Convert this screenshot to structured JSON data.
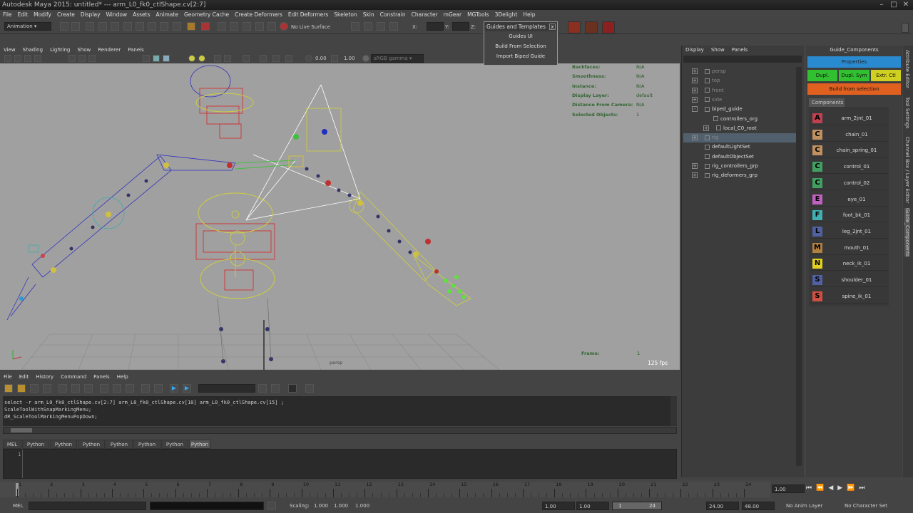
{
  "window": {
    "title": "Autodesk Maya 2015: untitled*   ---   arm_L0_fk0_ctlShape.cv[2:7]"
  },
  "menubar": {
    "items": [
      "File",
      "Edit",
      "Modify",
      "Create",
      "Display",
      "Window",
      "Assets",
      "Animate",
      "Geometry Cache",
      "Create Deformers",
      "Edit Deformers",
      "Skeleton",
      "Skin",
      "Constrain",
      "Character",
      "mGear",
      "MGTools",
      "3Delight",
      "Help"
    ]
  },
  "statusline": {
    "menuset": "Animation",
    "live_surface": "No Live Surface",
    "x_label": "X:",
    "y_label": "Y:",
    "z_label": "Z:"
  },
  "popup": {
    "title": "Guides and Templates",
    "close": "x",
    "items": [
      "Guides UI",
      "Build From Selection",
      "Import Biped Guide"
    ]
  },
  "viewport": {
    "menu": [
      "View",
      "Shading",
      "Lighting",
      "Show",
      "Renderer",
      "Panels"
    ],
    "exposure": "0.00",
    "gamma": "1.00",
    "color_space": "sRGB gamma",
    "camera": "persp",
    "fps": "125 fps",
    "hud": [
      {
        "k": "Backfaces:",
        "v": "N/A"
      },
      {
        "k": "Smoothness:",
        "v": "N/A"
      },
      {
        "k": "Instance:",
        "v": "N/A"
      },
      {
        "k": "Display Layer:",
        "v": "default"
      },
      {
        "k": "Distance From Camera:",
        "v": "N/A"
      },
      {
        "k": "Selected Objects:",
        "v": "1"
      }
    ],
    "frame_label": "Frame:",
    "frame_value": "1"
  },
  "outliner": {
    "menu": [
      "Display",
      "Show",
      "Panels"
    ],
    "rows": [
      {
        "label": "persp",
        "dim": true
      },
      {
        "label": "top",
        "dim": true
      },
      {
        "label": "front",
        "dim": true
      },
      {
        "label": "side",
        "dim": true
      },
      {
        "label": "biped_guide",
        "dim": false
      },
      {
        "label": "controllers_org",
        "dim": false
      },
      {
        "label": "local_C0_root",
        "dim": false
      },
      {
        "label": "rig",
        "dim": true
      },
      {
        "label": "defaultLightSet",
        "dim": false
      },
      {
        "label": "defaultObjectSet",
        "dim": false
      },
      {
        "label": "rig_controllers_grp",
        "dim": false
      },
      {
        "label": "rig_deformers_grp",
        "dim": false
      }
    ]
  },
  "guide_panel": {
    "title": "Guide_Components",
    "properties": "Properties",
    "dupl": "Dupl.",
    "dupl_sym": "Dupl. Sym",
    "extr_ctl": "Extr. Ctl",
    "build": "Build from selection",
    "components_tab": "Components",
    "components": [
      {
        "letter": "A",
        "name": "arm_2jnt_01",
        "color": "#c04050"
      },
      {
        "letter": "C",
        "name": "chain_01",
        "color": "#c09060"
      },
      {
        "letter": "C",
        "name": "chain_spring_01",
        "color": "#c09060"
      },
      {
        "letter": "C",
        "name": "control_01",
        "color": "#40a060"
      },
      {
        "letter": "C",
        "name": "control_02",
        "color": "#40a060"
      },
      {
        "letter": "E",
        "name": "eye_01",
        "color": "#c060c0"
      },
      {
        "letter": "F",
        "name": "foot_bk_01",
        "color": "#40b0b0"
      },
      {
        "letter": "L",
        "name": "leg_2jnt_01",
        "color": "#5060a0"
      },
      {
        "letter": "M",
        "name": "mouth_01",
        "color": "#b08040"
      },
      {
        "letter": "N",
        "name": "neck_ik_01",
        "color": "#e0d020"
      },
      {
        "letter": "S",
        "name": "shoulder_01",
        "color": "#5060a0"
      },
      {
        "letter": "S",
        "name": "spine_ik_01",
        "color": "#d05040"
      }
    ]
  },
  "side_tabs": [
    "Attribute Editor",
    "Tool Settings",
    "Channel Box / Layer Editor",
    "Guide_Components"
  ],
  "script_editor": {
    "menu": [
      "File",
      "Edit",
      "History",
      "Command",
      "Panels",
      "Help"
    ],
    "history": [
      "select -r arm_L0_fk0_ctlShape.cv[2:7] arm_L0_fk0_ctlShape.cv[10] arm_L0_fk0_ctlShape.cv[15] ;",
      "ScaleToolWithSnapMarkingMenu;",
      "dR_ScaleToolMarkingMenuPopDown;"
    ],
    "tabs": [
      "MEL",
      "Python",
      "Python",
      "Python",
      "Python",
      "Python",
      "Python",
      "Python"
    ],
    "line_number": "1"
  },
  "timeline": {
    "ticks": [
      "1",
      "2",
      "3",
      "4",
      "5",
      "6",
      "7",
      "8",
      "9",
      "10",
      "11",
      "12",
      "13",
      "14",
      "15",
      "16",
      "17",
      "18",
      "19",
      "20",
      "21",
      "22",
      "23",
      "24"
    ],
    "current": "1.00"
  },
  "range": {
    "mel": "MEL",
    "scaling_label": "Scaling:",
    "scaling": [
      "1.000",
      "1.000",
      "1.000"
    ],
    "start": "1.00",
    "start2": "1.00",
    "slider_start": "1",
    "slider_end": "24",
    "end": "24.00",
    "end2": "48.00",
    "anim_layer": "No Anim Layer",
    "char_set": "No Character Set"
  }
}
